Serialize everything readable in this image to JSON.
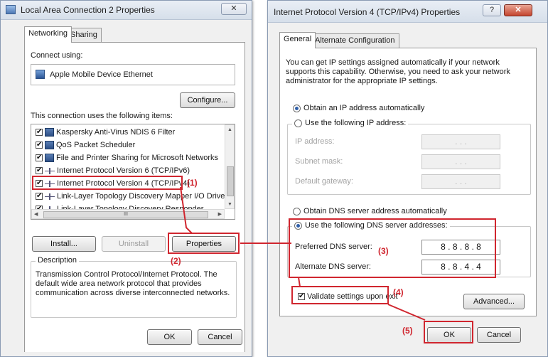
{
  "left_dialog": {
    "title": "Local Area Connection 2 Properties",
    "close_glyph": "✕",
    "tabs": [
      {
        "label": "Networking",
        "active": true
      },
      {
        "label": "Sharing",
        "active": false
      }
    ],
    "connect_using_label": "Connect using:",
    "adapter_name": "Apple Mobile Device Ethernet",
    "configure_label": "Configure...",
    "items_label": "This connection uses the following items:",
    "items": [
      {
        "label": "Kaspersky Anti-Virus NDIS 6 Filter",
        "checked": true,
        "icon": "network-client-icon"
      },
      {
        "label": "QoS Packet Scheduler",
        "checked": true,
        "icon": "network-client-icon"
      },
      {
        "label": "File and Printer Sharing for Microsoft Networks",
        "checked": true,
        "icon": "network-client-icon"
      },
      {
        "label": "Internet Protocol Version 6 (TCP/IPv6)",
        "checked": true,
        "icon": "protocol-icon"
      },
      {
        "label": "Internet Protocol Version 4 (TCP/IPv4)",
        "checked": true,
        "icon": "protocol-icon"
      },
      {
        "label": "Link-Layer Topology Discovery Mapper I/O Driver",
        "checked": true,
        "icon": "protocol-icon"
      },
      {
        "label": "Link-Layer Topology Discovery Responder",
        "checked": true,
        "icon": "protocol-icon"
      }
    ],
    "check_glyph": "✔",
    "scroll_thumb_glyph": "III",
    "install_label": "Install...",
    "uninstall_label": "Uninstall",
    "properties_label": "Properties",
    "description_title": "Description",
    "description_text": "Transmission Control Protocol/Internet Protocol. The default wide area network protocol that provides communication across diverse interconnected networks.",
    "ok_label": "OK",
    "cancel_label": "Cancel"
  },
  "right_dialog": {
    "title": "Internet Protocol Version 4 (TCP/IPv4) Properties",
    "help_glyph": "?",
    "close_glyph": "✕",
    "tabs": [
      {
        "label": "General",
        "active": true
      },
      {
        "label": "Alternate Configuration",
        "active": false
      }
    ],
    "intro_text": "You can get IP settings assigned automatically if your network supports this capability. Otherwise, you need to ask your network administrator for the appropriate IP settings.",
    "obtain_ip_auto_label": "Obtain an IP address automatically",
    "use_following_ip_label": "Use the following IP address:",
    "ip_address_label": "IP address:",
    "subnet_mask_label": "Subnet mask:",
    "default_gateway_label": "Default gateway:",
    "empty_ip_value": ".   .   .",
    "obtain_dns_auto_label": "Obtain DNS server address automatically",
    "use_following_dns_label": "Use the following DNS server addresses:",
    "preferred_dns_label": "Preferred DNS server:",
    "preferred_dns_value": "8 . 8 . 8 . 8",
    "alternate_dns_label": "Alternate DNS server:",
    "alternate_dns_value": "8 . 8 . 4 . 4",
    "validate_label": "Validate settings upon exit",
    "validate_checked": true,
    "advanced_label": "Advanced...",
    "ok_label": "OK",
    "cancel_label": "Cancel"
  },
  "annotations": {
    "step1": "(1)",
    "step2": "(2)",
    "step3": "(3)",
    "step4": "(4)",
    "step5": "(5)",
    "highlight_color": "#d0262f"
  }
}
